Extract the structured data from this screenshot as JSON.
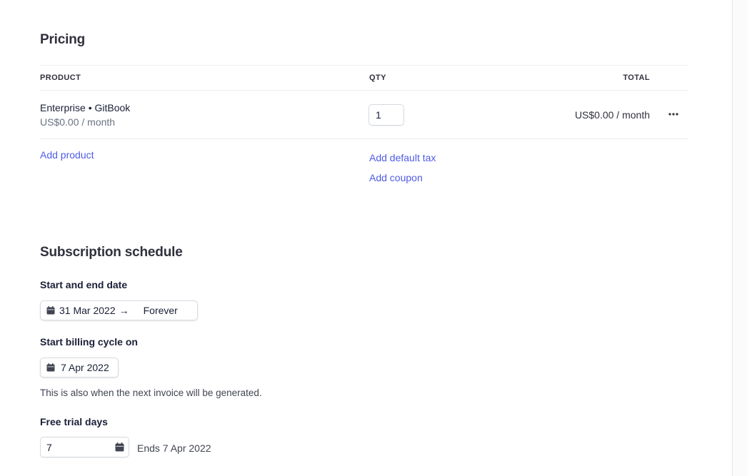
{
  "pricing": {
    "title": "Pricing",
    "columns": {
      "product": "PRODUCT",
      "qty": "QTY",
      "total": "TOTAL"
    },
    "line_items": [
      {
        "name": "Enterprise • GitBook",
        "price": "US$0.00 / month",
        "qty": "1",
        "total": "US$0.00 / month"
      }
    ],
    "add_product_label": "Add product",
    "add_default_tax_label": "Add default tax",
    "add_coupon_label": "Add coupon"
  },
  "schedule": {
    "title": "Subscription schedule",
    "start_end_label": "Start and end date",
    "start_date": "31 Mar 2022",
    "arrow": "→",
    "end_date": "Forever",
    "billing_cycle_label": "Start billing cycle on",
    "billing_cycle_date": "7 Apr 2022",
    "billing_help": "This is also when the next invoice will be generated.",
    "trial_label": "Free trial days",
    "trial_days": "7",
    "trial_ends": "Ends 7 Apr 2022"
  },
  "icons": {
    "more": "more-horizontal-icon",
    "calendar": "calendar-icon"
  },
  "colors": {
    "link": "#4e5be5",
    "text": "#1a1f36",
    "muted": "#6a7383",
    "border": "#d5dbe1"
  }
}
